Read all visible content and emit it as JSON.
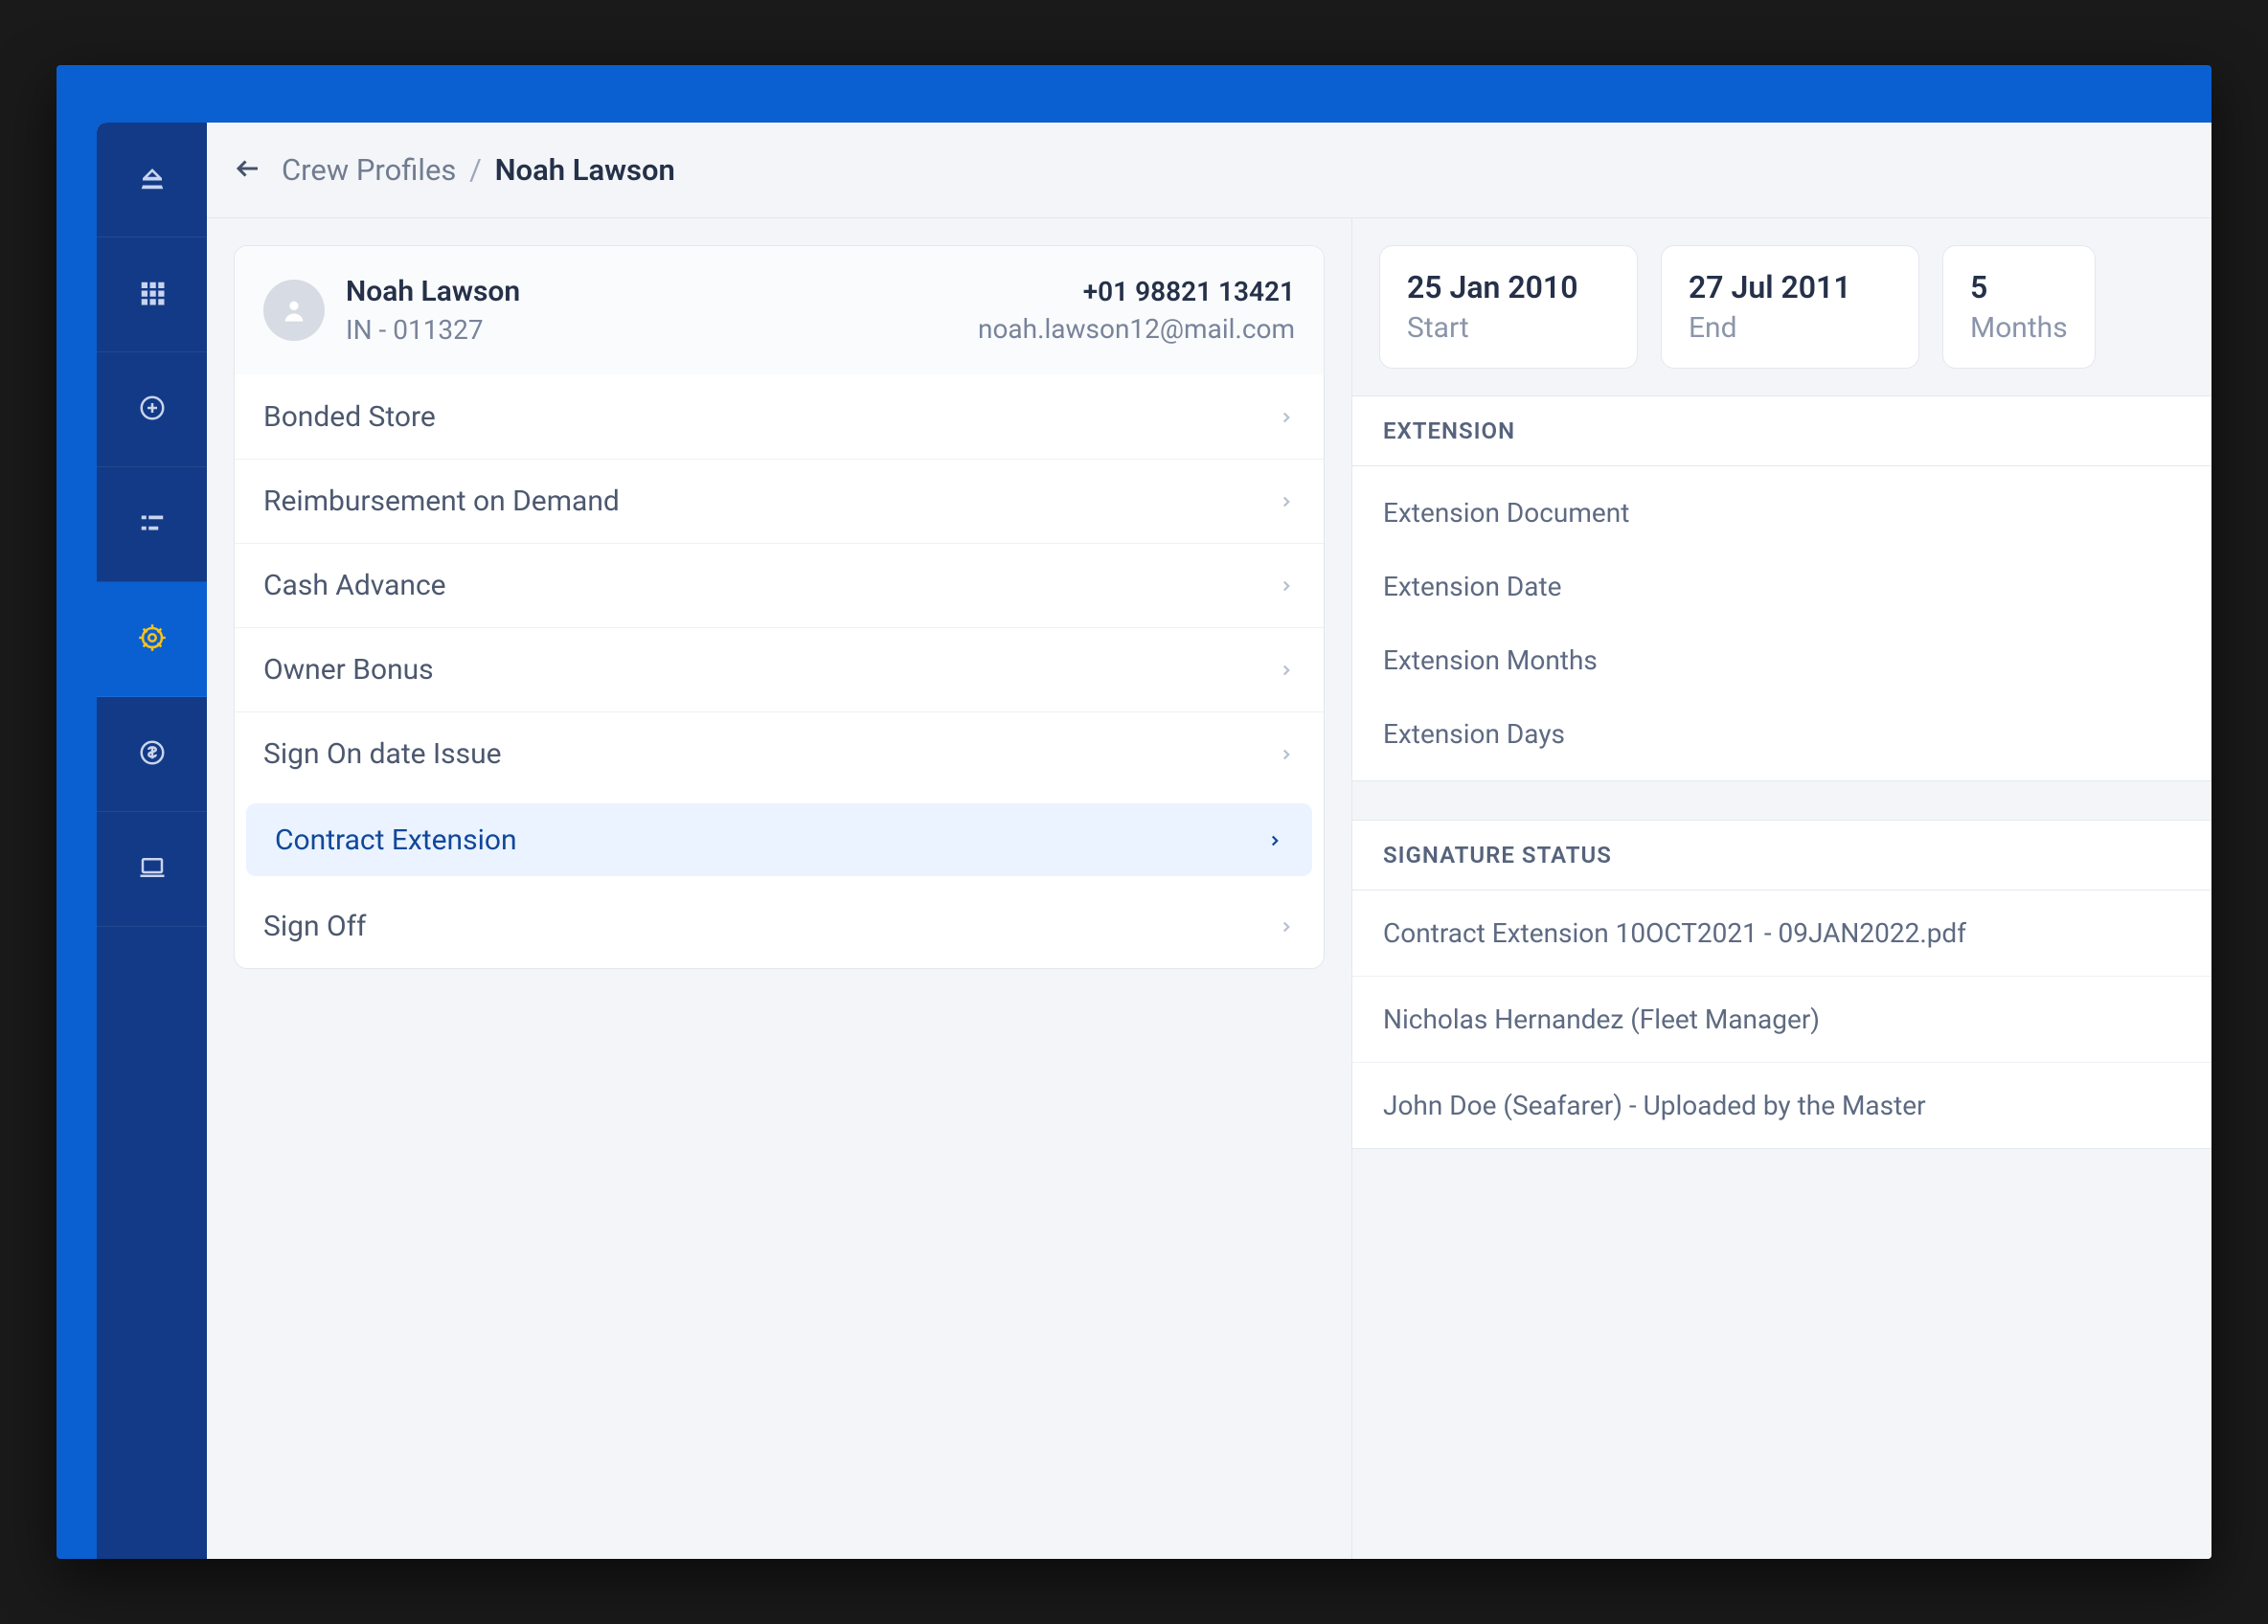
{
  "breadcrumb": {
    "parent": "Crew Profiles",
    "current": "Noah Lawson"
  },
  "profile": {
    "name": "Noah Lawson",
    "code": "IN - 011327",
    "phone": "+01 98821 13421",
    "email": "noah.lawson12@mail.com"
  },
  "menu": {
    "items": [
      {
        "label": "Bonded Store",
        "active": false
      },
      {
        "label": "Reimbursement on Demand",
        "active": false
      },
      {
        "label": "Cash Advance",
        "active": false
      },
      {
        "label": "Owner Bonus",
        "active": false
      },
      {
        "label": "Sign On date Issue",
        "active": false
      },
      {
        "label": "Contract Extension",
        "active": true
      },
      {
        "label": "Sign Off",
        "active": false
      }
    ]
  },
  "stats": [
    {
      "value": "25 Jan 2010",
      "label": "Start"
    },
    {
      "value": "27 Jul 2011",
      "label": "End"
    },
    {
      "value": "5",
      "label": "Months"
    }
  ],
  "extension": {
    "title": "EXTENSION",
    "rows": [
      "Extension Document",
      "Extension Date",
      "Extension Months",
      "Extension Days"
    ]
  },
  "signature": {
    "title": "SIGNATURE STATUS",
    "rows": [
      "Contract Extension 10OCT2021 - 09JAN2022.pdf",
      "Nicholas Hernandez (Fleet Manager)",
      "John Doe (Seafarer) - Uploaded by the Master"
    ]
  }
}
